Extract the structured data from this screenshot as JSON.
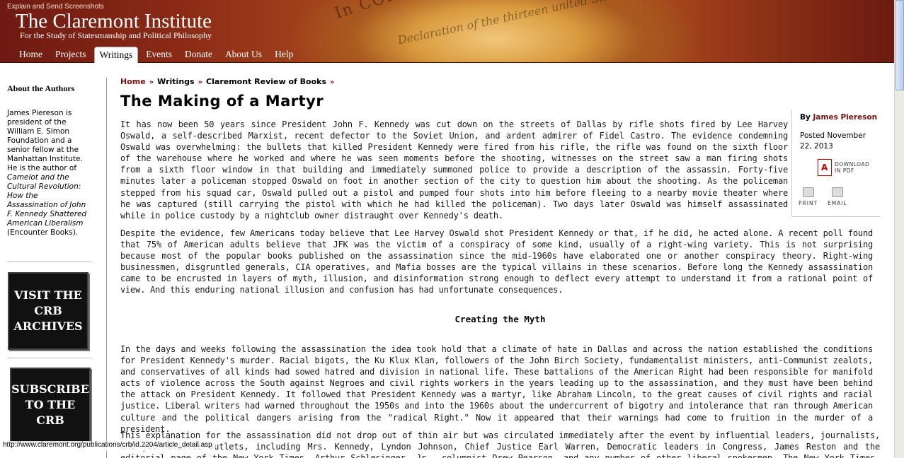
{
  "header": {
    "tooltip_caption": "Explain and Send Screenshots",
    "title": "The Claremont Institute",
    "tagline": "For the Study of Statesmanship and Political Philosophy",
    "document_text": "In CONGRESS",
    "document_text2": "Declaration of the thirteen united States"
  },
  "nav": {
    "items": [
      "Home",
      "Projects",
      "Writings",
      "Events",
      "Donate",
      "About Us",
      "Help"
    ],
    "active": "Writings"
  },
  "sidebar": {
    "heading": "About the Authors",
    "bio_plain": "James Piereson is president of the William E. Simon Foundation and a senior fellow at the Manhattan Institute. He is the author of",
    "bio_book": "Camelot and the Cultural Revolution: How the Assassination of John F. Kennedy Shattered American Liberalism",
    "bio_publisher": "(Encounter Books).",
    "promo1": [
      "VISIT THE",
      "CRB",
      "ARCHIVES"
    ],
    "promo2": [
      "SUBSCRIBE",
      "TO THE",
      "CRB"
    ]
  },
  "breadcrumb": {
    "items": [
      "Home",
      "Writings",
      "Claremont Review of Books"
    ],
    "separator": "»"
  },
  "article": {
    "title": "The Making of a Martyr",
    "p1": "It has now been 50 years since President John F. Kennedy was cut down on the streets of Dallas by rifle shots fired by Lee Harvey Oswald, a self-described Marxist, recent defector to the Soviet Union, and ardent admirer of Fidel Castro. The evidence condemning Oswald was overwhelming: the bullets that killed President Kennedy were fired from his rifle, the rifle was found on the sixth floor of the warehouse where he worked and where he was seen moments before the shooting, witnesses on the street saw a man firing shots from a sixth floor window in that building and immediately summoned police to provide a description of the assassin. Forty-five minutes later a policeman stopped Oswald on foot in another section of the city to question him about the shooting. As the policeman stepped from his squad car, Oswald pulled out a pistol and pumped four shots into him before fleeing to a nearby movie theater where he was captured (still carrying the pistol with which he had killed the policeman). Two days later Oswald was himself assassinated while in police custody by a nightclub owner distraught over Kennedy's death.",
    "p2": "Despite the evidence, few Americans today believe that Lee Harvey Oswald shot President Kennedy or that, if he did, he acted alone. A recent poll found that 75% of American adults believe that JFK was the victim of a conspiracy of some kind, usually of a right-wing variety. This is not surprising because most of the popular books published on the assassination since the mid-1960s have elaborated one or another conspiracy theory. Right-wing businessmen, disgruntled generals, CIA operatives, and Mafia bosses are the typical villains in these scenarios. Before long the Kennedy assassination came to be encrusted in layers of myth, illusion, and disinformation strong enough to deflect every attempt to understand it from a rational point of view. And this enduring national illusion and confusion has had unfortunate consequences.",
    "subhead": "Creating the Myth",
    "p3": "In the days and weeks following the assassination the idea took hold that a climate of hate in Dallas and across the nation established the conditions for President Kennedy's murder. Racial bigots, the Ku Klux Klan, followers of the John Birch Society, fundamentalist ministers, anti-Communist zealots, and conservatives of all kinds had sowed hatred and division in national life. These battalions of the American Right had been responsible for manifold acts of violence across the South against Negroes and civil rights workers in the years leading up to the assassination, and they must have been behind the attack on President Kennedy. It followed that President Kennedy was a martyr, like Abraham Lincoln, to the great causes of civil rights and racial justice. Liberal writers had warned throughout the 1950s and into the 1960s about the undercurrent of bigotry and intolerance that ran through American culture and the political dangers arising from the \"radical Right.\" Now it appeared that their warnings had come to fruition in the murder of a president.",
    "p4": "This explanation for the assassination did not drop out of thin air but was circulated immediately after the event by influential leaders, journalists, and journalistic outlets, including Mrs. Kennedy, Lyndon Johnson, Chief Justice Earl Warren, Democratic leaders in Congress, James Reston and the editorial page of the New York Times, Arthur Schlesinger, Jr., columnist Drew Pearson, and any number of other liberal spokesmen. The New York Times, through its editorial page"
  },
  "infobox": {
    "by_label": "By",
    "author": "James Piereson",
    "posted": "Posted November 22, 2013",
    "pdf_label": "DOWNLOAD IN PDF",
    "print_label": "PRINT",
    "email_label": "EMAIL"
  },
  "statusbar": {
    "url": "http://www.claremont.org/publications/crb/id.2204/article_detail.asp"
  }
}
